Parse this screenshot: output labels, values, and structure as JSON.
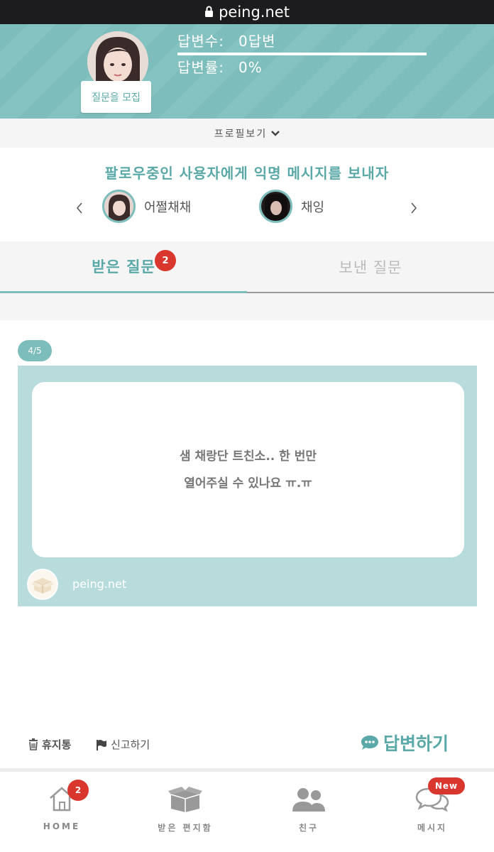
{
  "browser": {
    "url": "peing.net"
  },
  "profile": {
    "recruit_button": "질문을 모집",
    "answers_label": "답변수:",
    "answers_value": "0답변",
    "rate_label": "답변률:",
    "rate_value": "0%",
    "toggle_label": "프로필보기"
  },
  "follow": {
    "title": "팔로우중인 사용자에게 익명 메시지를 보내자",
    "friends": [
      {
        "name": "어쩔채채"
      },
      {
        "name": "채잉"
      }
    ]
  },
  "tabs": {
    "received": "받은 질문",
    "received_badge": "2",
    "sent": "보낸 질문"
  },
  "question": {
    "counter": "4/5",
    "line1": "샘 채랑단 트친소.. 한 번만",
    "line2": "열어주실 수 있나요 ㅠ.ㅠ",
    "site": "peing.net"
  },
  "actions": {
    "trash": "휴지통",
    "report": "신고하기",
    "reply": "답변하기"
  },
  "nav": {
    "home": "HOME",
    "home_badge": "2",
    "inbox": "받은 편지함",
    "friends": "친구",
    "messages": "메시지",
    "messages_badge": "New"
  },
  "colors": {
    "accent": "#7dbdbc",
    "accent_dark": "#5aa9a8",
    "card_bg": "#b8dbdc",
    "badge": "#d9372e"
  }
}
